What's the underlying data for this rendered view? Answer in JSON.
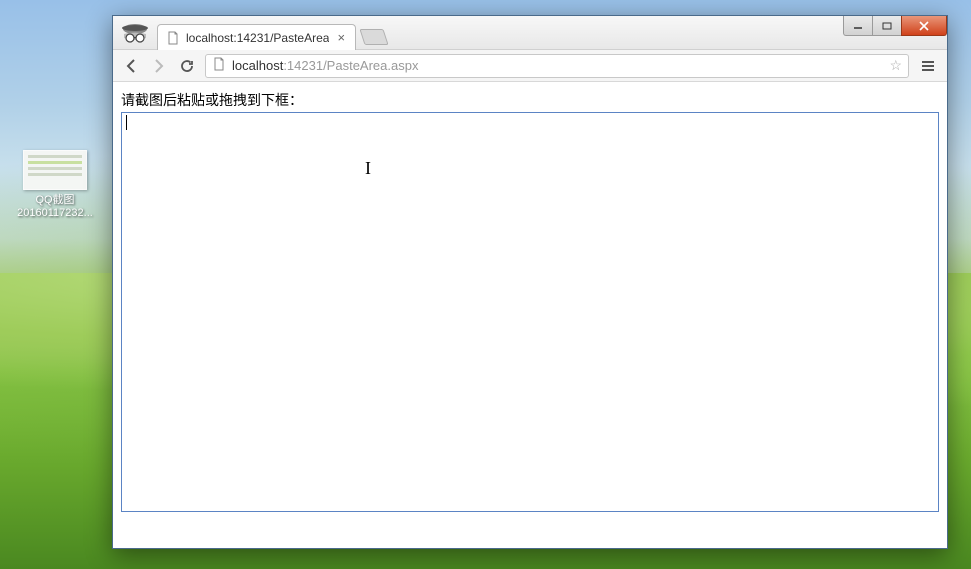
{
  "desktop": {
    "icon": {
      "name_line1": "QQ截图",
      "name_line2": "20160117232..."
    }
  },
  "browser": {
    "tab": {
      "title": "localhost:14231/PasteArea"
    },
    "address": {
      "host": "localhost",
      "path": ":14231/PasteArea.aspx"
    }
  },
  "page": {
    "instruction": "请截图后粘贴或拖拽到下框："
  }
}
